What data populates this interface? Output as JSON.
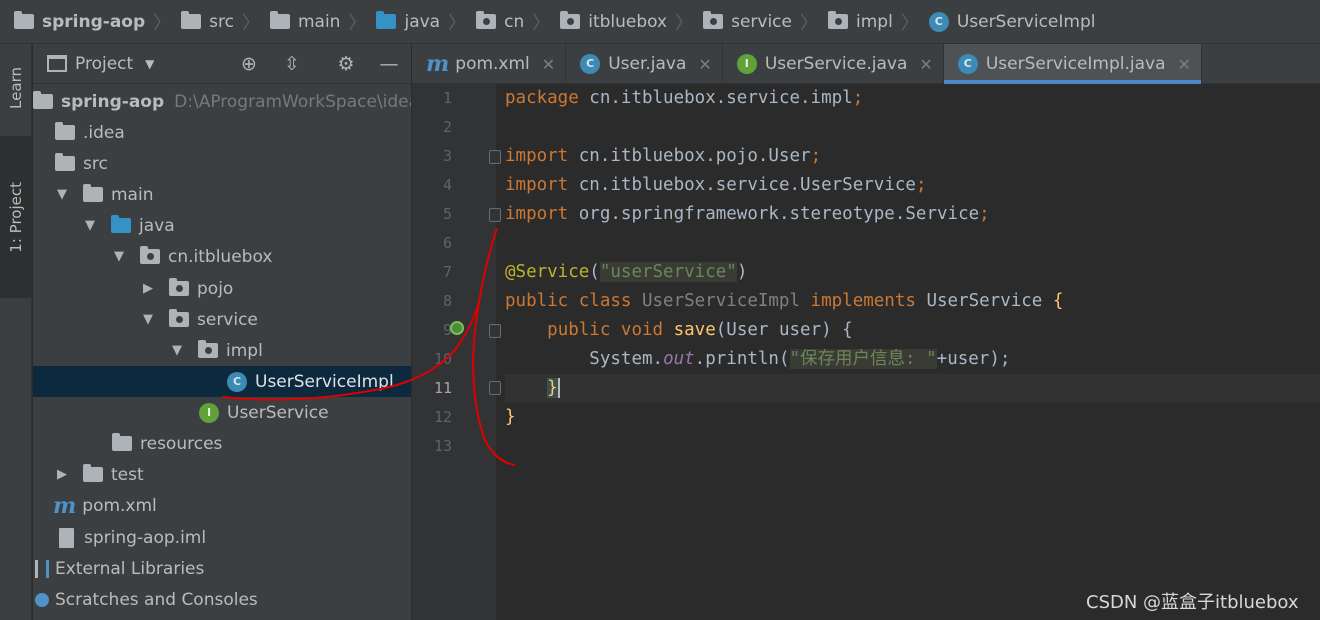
{
  "breadcrumb": {
    "items": [
      {
        "label": "spring-aop",
        "icon": "module-folder-icon"
      },
      {
        "label": "src",
        "icon": "folder-icon"
      },
      {
        "label": "main",
        "icon": "folder-icon"
      },
      {
        "label": "java",
        "icon": "source-folder-icon"
      },
      {
        "label": "cn",
        "icon": "package-icon"
      },
      {
        "label": "itbluebox",
        "icon": "package-icon"
      },
      {
        "label": "service",
        "icon": "package-icon"
      },
      {
        "label": "impl",
        "icon": "package-icon"
      },
      {
        "label": "UserServiceImpl",
        "icon": "class-icon"
      }
    ]
  },
  "left_strip": {
    "learn": "Learn",
    "project": "1: Project"
  },
  "project_panel": {
    "title": "Project",
    "tree": [
      {
        "label": "spring-aop",
        "hint": "D:\\AProgramWorkSpace\\idea\\s"
      },
      {
        "label": ".idea"
      },
      {
        "label": "src"
      },
      {
        "label": "main"
      },
      {
        "label": "java"
      },
      {
        "label": "cn.itbluebox"
      },
      {
        "label": "pojo"
      },
      {
        "label": "service"
      },
      {
        "label": "impl"
      },
      {
        "label": "UserServiceImpl"
      },
      {
        "label": "UserService"
      },
      {
        "label": "resources"
      },
      {
        "label": "test"
      },
      {
        "label": "pom.xml"
      },
      {
        "label": "spring-aop.iml"
      },
      {
        "label": "External Libraries"
      },
      {
        "label": "Scratches and Consoles"
      }
    ]
  },
  "editor_tabs": [
    {
      "label": "pom.xml",
      "icon": "maven-icon",
      "active": false
    },
    {
      "label": "User.java",
      "icon": "class-icon",
      "active": false
    },
    {
      "label": "UserService.java",
      "icon": "interface-icon",
      "active": false
    },
    {
      "label": "UserServiceImpl.java",
      "icon": "class-icon",
      "active": true
    }
  ],
  "editor": {
    "line_numbers": [
      "1",
      "2",
      "3",
      "4",
      "5",
      "6",
      "7",
      "8",
      "9",
      "10",
      "11",
      "12",
      "13"
    ],
    "current_line": "11",
    "code": {
      "l1": {
        "kw": "package ",
        "pkg": "cn.itbluebox.service.impl",
        "end": ";"
      },
      "l3": {
        "kw": "import ",
        "pkg": "cn.itbluebox.pojo.",
        "cls": "User",
        "end": ";"
      },
      "l4": {
        "kw": "import ",
        "pkg": "cn.itbluebox.service.",
        "cls": "UserService",
        "end": ";"
      },
      "l5": {
        "kw": "import ",
        "pkg": "org.springframework.stereotype.",
        "cls": "Service",
        "end": ";"
      },
      "l7": {
        "ann": "@Service",
        "open": "(",
        "str": "\"userService\"",
        "close": ")"
      },
      "l8": {
        "kw1": "public class ",
        "name": "UserServiceImpl",
        "kw2": " implements ",
        "iface": "UserService",
        "brace": " {"
      },
      "l9": {
        "indent": "    ",
        "kw": "public void ",
        "fn": "save",
        "params": "(User user) {"
      },
      "l10": {
        "indent": "        ",
        "cls": "System.",
        "fld": "out",
        "call": ".println(",
        "str": "\"保存用户信息: \"",
        "rest": "+user);"
      },
      "l11": {
        "indent": "    ",
        "brace": "}"
      },
      "l12": {
        "brace": "}"
      }
    }
  },
  "watermark": "CSDN @蓝盒子itbluebox",
  "colors": {
    "keyword": "#cc7832",
    "string": "#6a8759",
    "annotation": "#bbb529",
    "method": "#ffc66d",
    "field": "#9876aa",
    "selection": "#0d293e",
    "active_tab_underline": "#4a88c7",
    "annotation_stroke": "#e00000"
  }
}
